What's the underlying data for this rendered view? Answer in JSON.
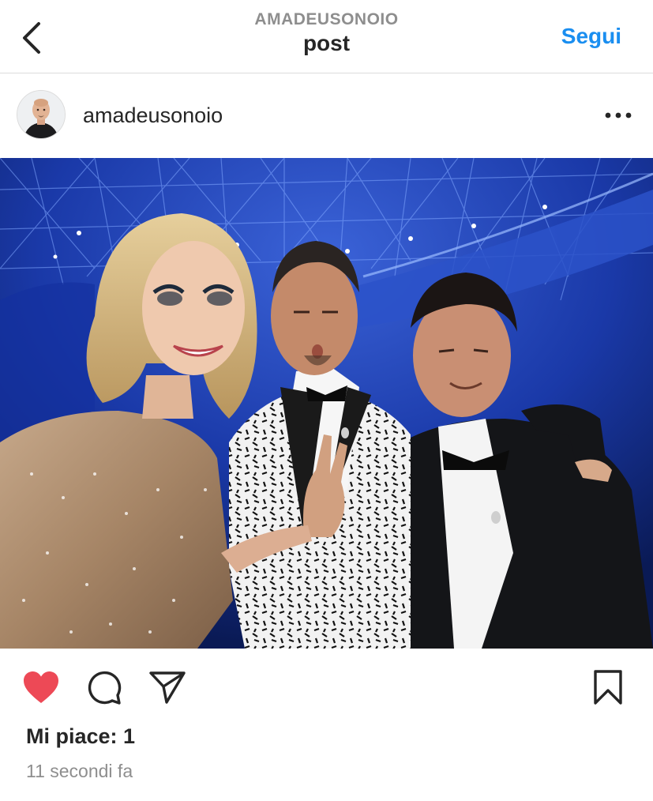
{
  "header": {
    "account_label": "AMADEUSONOIO",
    "title": "post",
    "follow_label": "Segui"
  },
  "post": {
    "username": "amadeusonoio",
    "likes_text": "Mi piace: 1",
    "time_text": "11 secondi fa",
    "liked": true
  },
  "icons": {
    "back": "chevron-left-icon",
    "more": "more-horizontal-icon",
    "like": "heart-icon",
    "comment": "comment-icon",
    "share": "send-icon",
    "save": "bookmark-icon"
  },
  "colors": {
    "accent_blue": "#1a8ef0",
    "like_red": "#ed4956",
    "muted_gray": "#8e8e8e",
    "text": "#262626"
  }
}
